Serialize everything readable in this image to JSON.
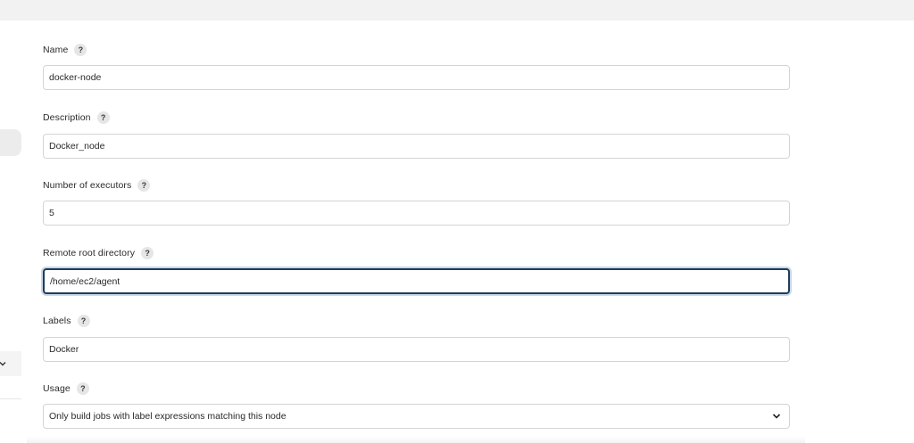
{
  "form": {
    "name": {
      "label": "Name",
      "help": "?",
      "value": "docker-node"
    },
    "description": {
      "label": "Description",
      "help": "?",
      "value": "Docker_node"
    },
    "executors": {
      "label": "Number of executors",
      "help": "?",
      "value": "5"
    },
    "remote_root": {
      "label": "Remote root directory",
      "help": "?",
      "value": "/home/ec2/agent"
    },
    "labels": {
      "label": "Labels",
      "help": "?",
      "value": "Docker"
    },
    "usage": {
      "label": "Usage",
      "help": "?",
      "selected": "Only build jobs with label expressions matching this node"
    }
  },
  "icons": {
    "help": "question-mark-icon",
    "dropdown": "chevron-down-icon"
  },
  "colors": {
    "focus_border": "#1f3d55",
    "input_border": "#d4d4d4",
    "help_bg": "#e6e6e6"
  }
}
